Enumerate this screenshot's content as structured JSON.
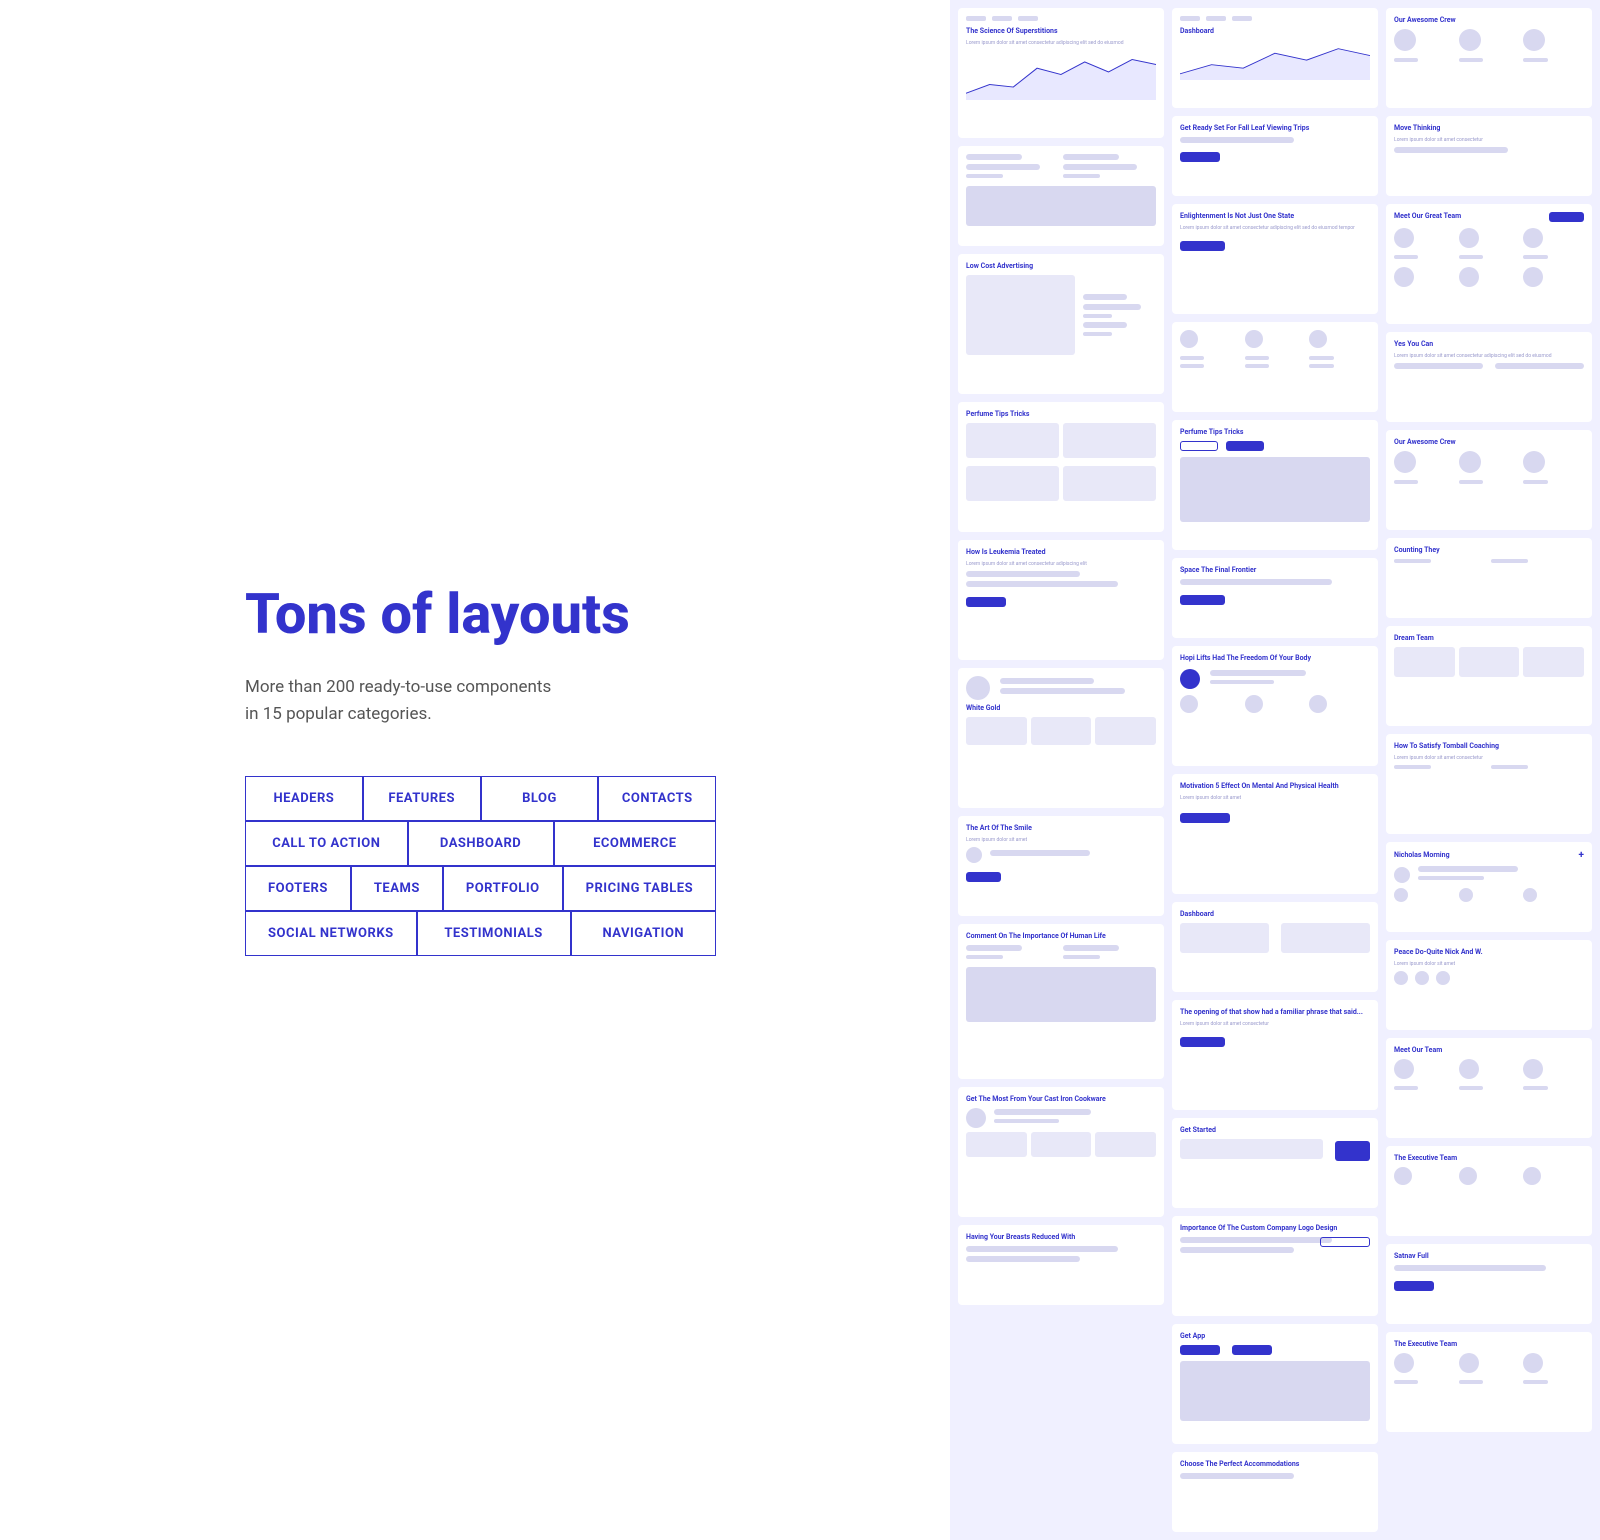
{
  "heading": "Tons of layouts",
  "subtitle_line1": "More than 200 ready-to-use components",
  "subtitle_line2": "in 15 popular categories.",
  "tags_row1": [
    "HEADERS",
    "FEATURES",
    "BLOG",
    "CONTACTS"
  ],
  "tags_row2": [
    "CALL TO ACTION",
    "DASHBOARD",
    "ECOMMERCE"
  ],
  "tags_row3": [
    "FOOTERS",
    "TEAMS",
    "PORTFOLIO",
    "PRICING TABLES"
  ],
  "tags_row4": [
    "SOCIAL NETWORKS",
    "TESTIMONIALS",
    "NAVIGATION"
  ],
  "accent_color": "#3333cc"
}
